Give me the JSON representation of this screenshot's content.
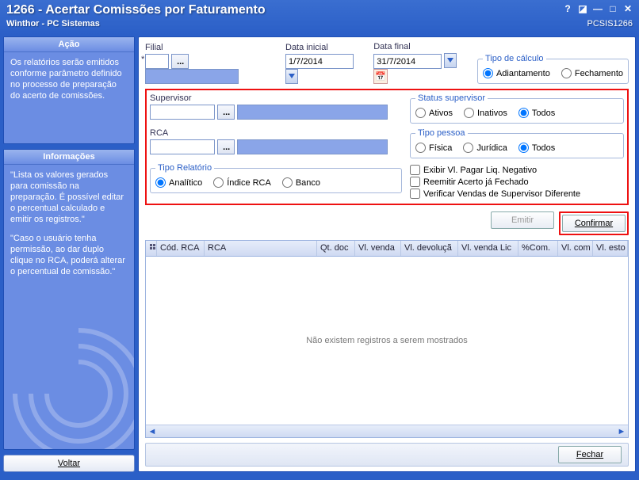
{
  "title": "1266 - Acertar Comissões por Faturamento",
  "subtitle": "Winthor - PC Sistemas",
  "module": "PCSIS1266",
  "sidebar": {
    "action": {
      "head": "Ação",
      "text": "Os relatórios serão emitidos conforme parâmetro definido no processo de preparação do acerto de comissões."
    },
    "info": {
      "head": "Informações",
      "text1": "\"Lista os valores gerados para comissão na preparação. É possível editar o percentual calculado e emitir os registros.\"",
      "text2": "\"Caso o usuário tenha permissão, ao dar duplo clique no RCA, poderá alterar o percentual de comissão.\""
    },
    "voltar": "Voltar"
  },
  "filters": {
    "filial": {
      "label": "Filial",
      "value": ""
    },
    "data_inicial": {
      "label": "Data inicial",
      "value": "1/7/2014"
    },
    "data_final": {
      "label": "Data final",
      "value": "31/7/2014"
    },
    "tipo_calculo": {
      "legend": "Tipo de cálculo",
      "adiantamento": "Adiantamento",
      "fechamento": "Fechamento",
      "selected": "adiantamento"
    },
    "supervisor": {
      "label": "Supervisor",
      "value": ""
    },
    "rca": {
      "label": "RCA",
      "value": ""
    },
    "status_supervisor": {
      "legend": "Status supervisor",
      "ativos": "Ativos",
      "inativos": "Inativos",
      "todos": "Todos",
      "selected": "todos"
    },
    "tipo_pessoa": {
      "legend": "Tipo pessoa",
      "fisica": "Física",
      "juridica": "Jurídica",
      "todos": "Todos",
      "selected": "todos"
    },
    "tipo_relatorio": {
      "legend": "Tipo Relatório",
      "analitico": "Analítico",
      "indice": "Índice RCA",
      "banco": "Banco",
      "selected": "analitico"
    },
    "checks": {
      "negativo": "Exibir Vl. Pagar Liq. Negativo",
      "reemitir": "Reemitir Acerto já Fechado",
      "verificar": "Verificar Vendas de Supervisor Diferente"
    }
  },
  "buttons": {
    "emitir": "Emitir",
    "confirmar": "Confirmar",
    "fechar": "Fechar"
  },
  "grid": {
    "columns": [
      "",
      "Cód. RCA",
      "RCA",
      "Qt. doc",
      "Vl. venda",
      "Vl. devoluçã",
      "Vl. venda Lic",
      "%Com.",
      "Vl. com",
      "Vl. esto"
    ],
    "empty": "Não existem registros a serem mostrados"
  }
}
